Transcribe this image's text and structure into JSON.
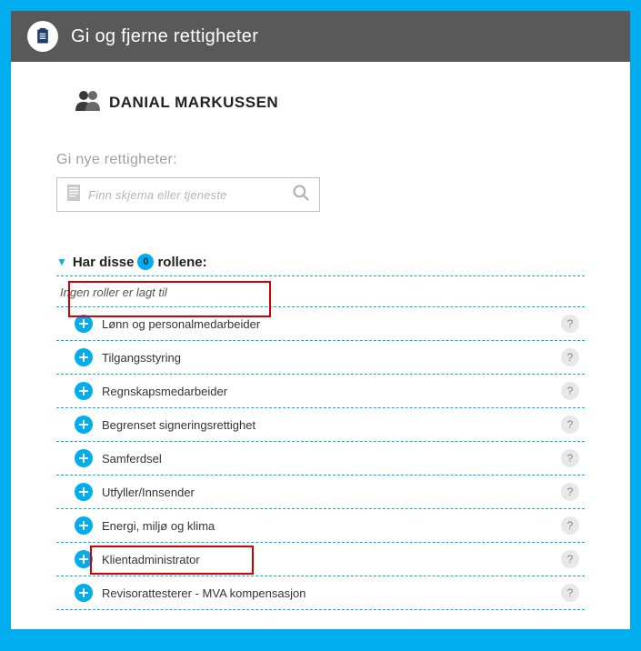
{
  "header": {
    "title": "Gi og fjerne rettigheter"
  },
  "person": {
    "name": "DANIAL MARKUSSEN"
  },
  "search": {
    "label": "Gi nye rettigheter:",
    "placeholder": "Finn skjema eller tjeneste"
  },
  "roles_section": {
    "prefix": "Har disse",
    "count": "0",
    "suffix": "rollene:",
    "empty_note": "Ingen roller er lagt til",
    "items": [
      {
        "label": "Lønn og personalmedarbeider"
      },
      {
        "label": "Tilgangsstyring"
      },
      {
        "label": "Regnskapsmedarbeider"
      },
      {
        "label": "Begrenset signeringsrettighet"
      },
      {
        "label": "Samferdsel"
      },
      {
        "label": "Utfyller/Innsender"
      },
      {
        "label": "Energi, miljø og klima"
      },
      {
        "label": "Klientadministrator"
      },
      {
        "label": "Revisorattesterer - MVA kompensasjon"
      }
    ]
  },
  "help_symbol": "?"
}
